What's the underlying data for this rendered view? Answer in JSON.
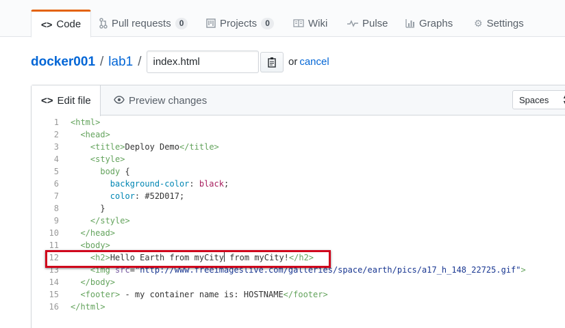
{
  "repo_nav": {
    "tabs": [
      {
        "label": "Code",
        "icon": "code-icon",
        "selected": true
      },
      {
        "label": "Pull requests",
        "icon": "pull-request-icon",
        "count": "0"
      },
      {
        "label": "Projects",
        "icon": "project-icon",
        "count": "0"
      },
      {
        "label": "Wiki",
        "icon": "book-icon"
      },
      {
        "label": "Pulse",
        "icon": "pulse-icon"
      },
      {
        "label": "Graphs",
        "icon": "graph-icon"
      },
      {
        "label": "Settings",
        "icon": "gear-icon"
      }
    ]
  },
  "breadcrumb": {
    "owner": "docker001",
    "repo": "lab1",
    "separator": "/",
    "filename": "index.html",
    "or_text": "or",
    "cancel_label": "cancel"
  },
  "editor": {
    "edit_tab_label": "Edit file",
    "preview_tab_label": "Preview changes",
    "indent_mode": "Spaces",
    "line_numbers": [
      "1",
      "2",
      "3",
      "4",
      "5",
      "6",
      "7",
      "8",
      "9",
      "10",
      "11",
      "12",
      "13",
      "14",
      "15",
      "16"
    ],
    "highlighted_line": 12
  },
  "colors": {
    "accent_link": "#0366d6",
    "selected_tab_border": "#e36209",
    "highlight_box": "#d0021b",
    "tag_green": "#63a35c"
  }
}
